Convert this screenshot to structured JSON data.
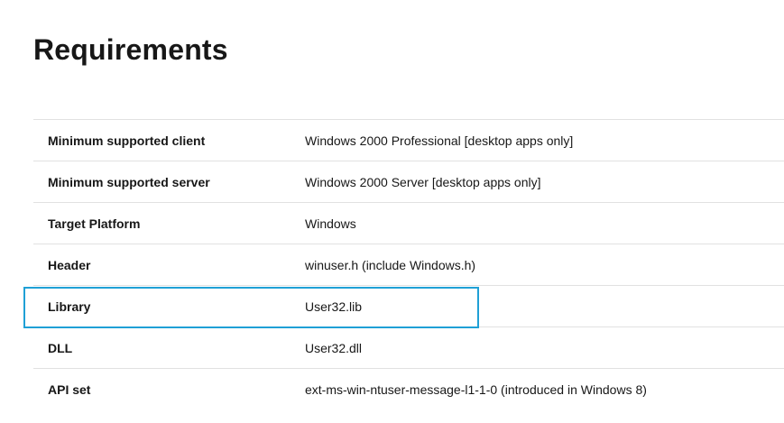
{
  "page": {
    "title": "Requirements"
  },
  "requirements": {
    "rows": [
      {
        "label": "Minimum supported client",
        "value": "Windows 2000 Professional [desktop apps only]"
      },
      {
        "label": "Minimum supported server",
        "value": "Windows 2000 Server [desktop apps only]"
      },
      {
        "label": "Target Platform",
        "value": "Windows"
      },
      {
        "label": "Header",
        "value": "winuser.h (include Windows.h)"
      },
      {
        "label": "Library",
        "value": "User32.lib",
        "focused": true
      },
      {
        "label": "DLL",
        "value": "User32.dll"
      },
      {
        "label": "API set",
        "value": "ext-ms-win-ntuser-message-l1-1-0 (introduced in Windows 8)"
      }
    ]
  },
  "colors": {
    "focus_outline": "#1fa0d6",
    "row_divider": "#e1e1e1",
    "text": "#171717"
  }
}
